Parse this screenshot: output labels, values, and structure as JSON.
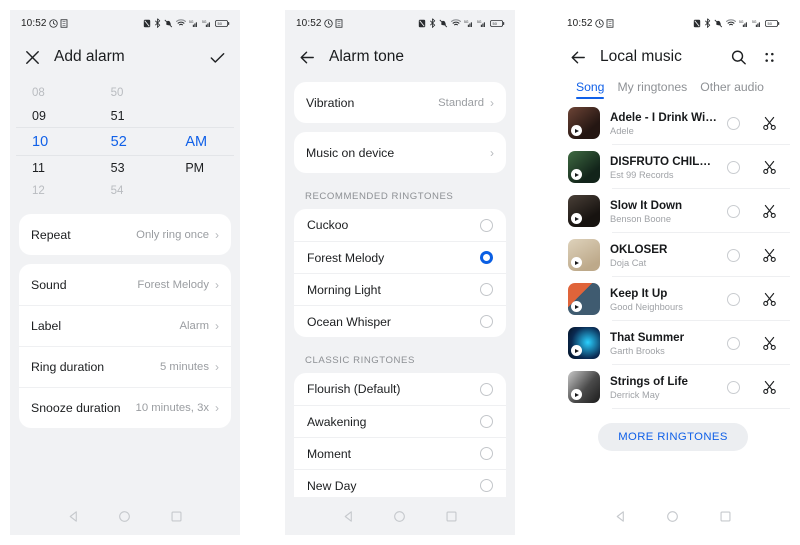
{
  "status_bar": {
    "time": "10:52",
    "left_icons": [
      "alarm-icon",
      "app-icon"
    ],
    "right_icons": [
      "mute-icon",
      "bluetooth-icon",
      "vibrate-off-icon",
      "wifi-icon",
      "signal-1-icon",
      "signal-2-icon",
      "battery-icon"
    ]
  },
  "colors": {
    "accent": "#1060e8",
    "radio_selected": "#0b5fe3",
    "page_bg": "#f1f2f4",
    "card_bg": "#ffffff",
    "muted_text": "#9a9da1"
  },
  "nav_bar": {
    "back": "back-triangle",
    "home": "home-circle",
    "recents": "recents-square"
  },
  "screen1": {
    "title": "Add alarm",
    "close_icon": "close-icon",
    "confirm_icon": "check-icon",
    "picker": {
      "hours": [
        "08",
        "09",
        "10",
        "11",
        "12"
      ],
      "minutes": [
        "50",
        "51",
        "52",
        "53",
        "54"
      ],
      "meridiem": [
        "",
        "",
        "AM",
        "PM",
        ""
      ],
      "selected_index": 2,
      "selected_hour": "10",
      "selected_minute": "52",
      "selected_meridiem": "AM"
    },
    "repeat_card": [
      {
        "label": "Repeat",
        "value": "Only ring once"
      }
    ],
    "settings_card": [
      {
        "label": "Sound",
        "value": "Forest Melody"
      },
      {
        "label": "Label",
        "value": "Alarm"
      },
      {
        "label": "Ring duration",
        "value": "5 minutes"
      },
      {
        "label": "Snooze duration",
        "value": "10 minutes, 3x"
      }
    ],
    "chevron": "›"
  },
  "screen2": {
    "title": "Alarm tone",
    "back_icon": "back-arrow-icon",
    "vibration": {
      "label": "Vibration",
      "value": "Standard"
    },
    "music_on_device": {
      "label": "Music on device",
      "value": ""
    },
    "recommended_header": "RECOMMENDED RINGTONES",
    "recommended": [
      {
        "label": "Cuckoo",
        "selected": false
      },
      {
        "label": "Forest Melody",
        "selected": true
      },
      {
        "label": "Morning Light",
        "selected": false
      },
      {
        "label": "Ocean Whisper",
        "selected": false
      }
    ],
    "classic_header": "CLASSIC RINGTONES",
    "classic": [
      {
        "label": "Flourish (Default)",
        "selected": false
      },
      {
        "label": "Awakening",
        "selected": false
      },
      {
        "label": "Moment",
        "selected": false
      },
      {
        "label": "New Day",
        "selected": false
      }
    ],
    "chevron": "›"
  },
  "screen3": {
    "title": "Local music",
    "back_icon": "back-arrow-icon",
    "search_icon": "search-icon",
    "menu_icon": "grid-menu-icon",
    "tabs": [
      {
        "label": "Song",
        "active": true
      },
      {
        "label": "My ringtones",
        "active": false
      },
      {
        "label": "Other audio",
        "active": false
      }
    ],
    "songs": [
      {
        "title": "Adele - I Drink Wine (O…",
        "artist": "Adele",
        "art": "#5a3a31",
        "selected": false
      },
      {
        "title": "DISFRUTO CHILL POP (…",
        "artist": "Est 99 Records",
        "art": "#2f4a34",
        "selected": false
      },
      {
        "title": "Slow It Down",
        "artist": "Benson Boone",
        "art": "#3a322c",
        "selected": false
      },
      {
        "title": "OKLOSER",
        "artist": "Doja Cat",
        "art": "#cdbfa5",
        "selected": false
      },
      {
        "title": "Keep It Up",
        "artist": "Good Neighbours",
        "art": "#9a5b3f",
        "selected": false
      },
      {
        "title": "That Summer",
        "artist": "Garth Brooks",
        "art": "#0d2240",
        "selected": false
      },
      {
        "title": "Strings of Life",
        "artist": "Derrick May",
        "art": "#6e6e6e",
        "selected": false
      }
    ],
    "more_button": "MORE RINGTONES",
    "trim_icon": "scissors-icon"
  }
}
